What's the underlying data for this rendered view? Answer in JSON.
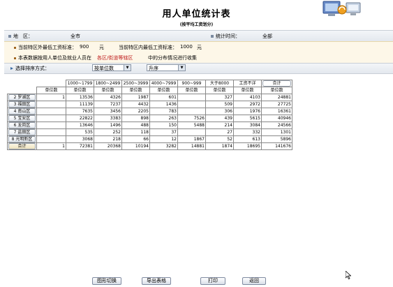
{
  "header": {
    "title": "用人单位统计表",
    "subtitle": "(按平均工资划分)"
  },
  "filter": {
    "region_label": "地　区：",
    "region_value": "全市",
    "time_label": "统计时间：",
    "time_value": "全部"
  },
  "notes": {
    "wage_outside_label": "当前特区外最低工资标准：",
    "wage_outside_value": "900",
    "wage_outside_unit": "元",
    "wage_inside_label": "当前特区内最低工资标准：",
    "wage_inside_value": "1000",
    "wage_inside_unit": "元",
    "scope_prefix": "本表数据按用人单位及就业人员在",
    "scope_link": "各区/街道等辖区",
    "scope_suffix": "中的分布情况进行收集"
  },
  "sort": {
    "label": "选择排序方式：",
    "by_value": "按单位数",
    "order_value": "升序"
  },
  "table": {
    "columns": [
      "1000~1799",
      "1800~2499",
      "2500~3999",
      "4000~7999",
      "900~999",
      "大于8000",
      "工资不详",
      "合计"
    ],
    "subheader": "单位数",
    "rows": [
      {
        "name": "罗湖区",
        "values": [
          "1",
          "13536",
          "4326",
          "1987",
          "601",
          "",
          "327",
          "4103",
          "24881"
        ]
      },
      {
        "name": "福田区",
        "values": [
          "",
          "11139",
          "7237",
          "4432",
          "1436",
          "",
          "509",
          "2972",
          "27725"
        ]
      },
      {
        "name": "南山区",
        "values": [
          "",
          "7635",
          "3456",
          "2205",
          "783",
          "",
          "306",
          "1976",
          "16361"
        ]
      },
      {
        "name": "宝安区",
        "values": [
          "",
          "22822",
          "3383",
          "898",
          "263",
          "7526",
          "439",
          "5615",
          "40946"
        ]
      },
      {
        "name": "龙岗区",
        "values": [
          "",
          "13646",
          "1496",
          "488",
          "150",
          "5488",
          "214",
          "3084",
          "24566"
        ]
      },
      {
        "name": "盐田区",
        "values": [
          "",
          "535",
          "252",
          "118",
          "37",
          "",
          "27",
          "332",
          "1301"
        ]
      },
      {
        "name": "光明新区",
        "values": [
          "",
          "3068",
          "218",
          "66",
          "12",
          "1867",
          "52",
          "613",
          "5896"
        ]
      }
    ],
    "row_numbers": [
      "2",
      "3",
      "4",
      "5",
      "6",
      "7",
      "8"
    ],
    "total": {
      "name": "合计",
      "values": [
        "1",
        "72381",
        "20368",
        "10194",
        "3282",
        "14881",
        "1874",
        "18695",
        "141676"
      ]
    }
  },
  "buttons": {
    "switch": "图形切换",
    "export": "导出表格",
    "print": "打印",
    "back": "返回"
  },
  "icons": [
    "computers-icon",
    "sort-icon",
    "cursor-icon"
  ]
}
